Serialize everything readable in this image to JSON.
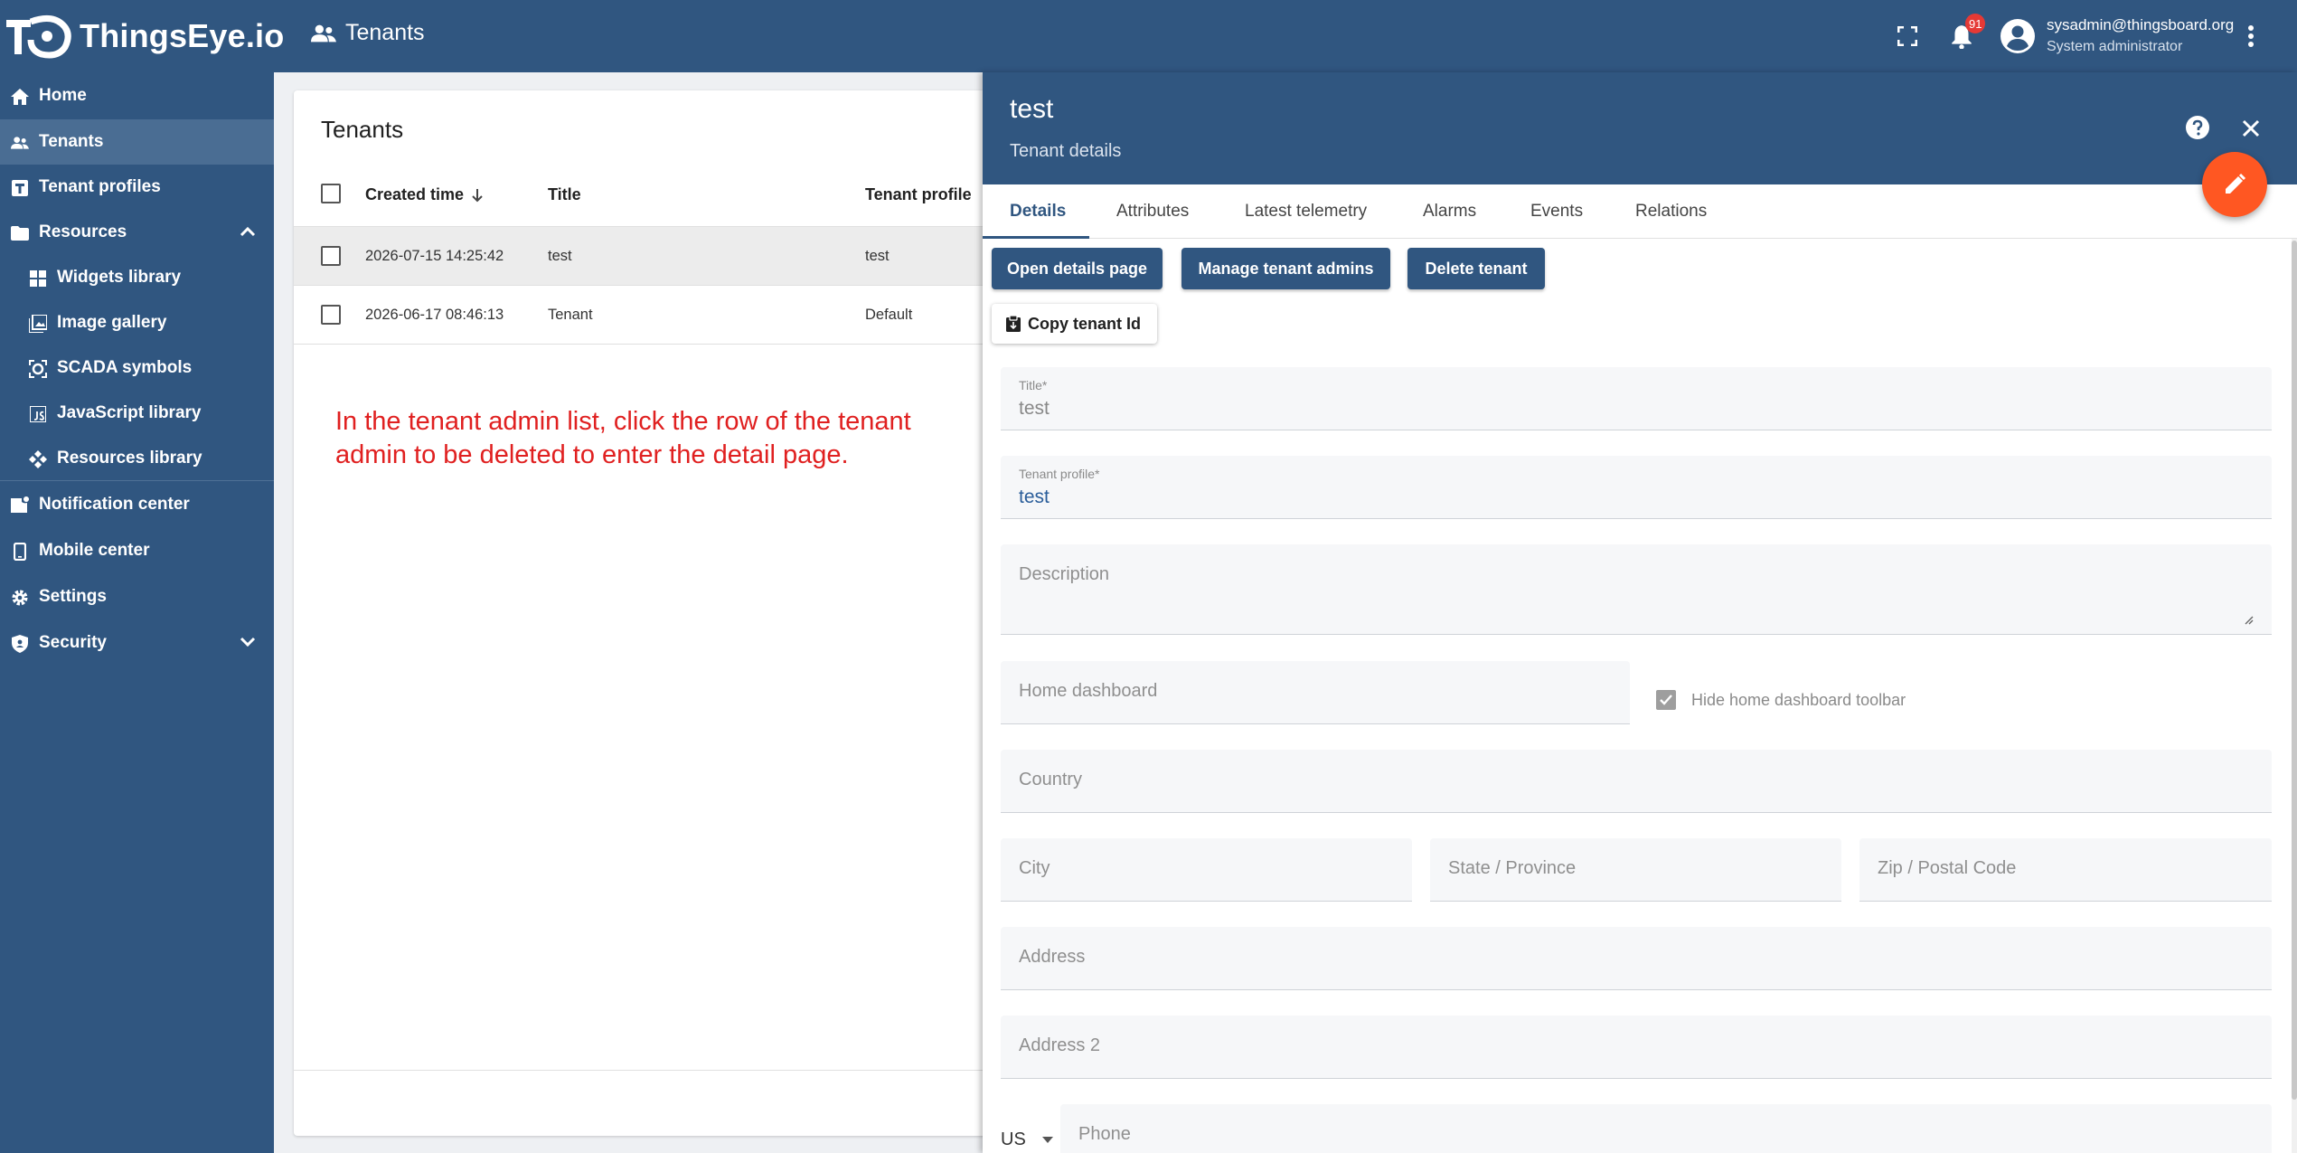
{
  "app": {
    "brand": "ThingsEye.io",
    "breadcrumb": "Tenants"
  },
  "topbar": {
    "notifications_count": "91",
    "user_email": "sysadmin@thingsboard.org",
    "user_role": "System administrator"
  },
  "sidebar": {
    "items": [
      {
        "label": "Home"
      },
      {
        "label": "Tenants"
      },
      {
        "label": "Tenant profiles"
      },
      {
        "label": "Resources"
      },
      {
        "label": "Widgets library"
      },
      {
        "label": "Image gallery"
      },
      {
        "label": "SCADA symbols"
      },
      {
        "label": "JavaScript library"
      },
      {
        "label": "Resources library"
      },
      {
        "label": "Notification center"
      },
      {
        "label": "Mobile center"
      },
      {
        "label": "Settings"
      },
      {
        "label": "Security"
      }
    ]
  },
  "tenants": {
    "title": "Tenants",
    "columns": [
      "Created time",
      "Title",
      "Tenant profile"
    ],
    "rows": [
      {
        "created": "2026-07-15 14:25:42",
        "title": "test",
        "profile": "test"
      },
      {
        "created": "2026-06-17 08:46:13",
        "title": "Tenant",
        "profile": "Default"
      }
    ],
    "annotation": "In the tenant admin list, click the row of the tenant admin to be deleted to enter the detail page."
  },
  "details": {
    "title": "test",
    "subtitle": "Tenant details",
    "tabs": [
      "Details",
      "Attributes",
      "Latest telemetry",
      "Alarms",
      "Events",
      "Relations"
    ],
    "buttons": {
      "open": "Open details page",
      "manage": "Manage tenant admins",
      "delete": "Delete tenant",
      "copy": "Copy tenant Id"
    },
    "fields": {
      "title_label": "Title*",
      "title_value": "test",
      "profile_label": "Tenant profile*",
      "profile_value": "test",
      "description": "Description",
      "home_dashboard": "Home dashboard",
      "hide_toolbar": "Hide home dashboard toolbar",
      "country": "Country",
      "city": "City",
      "state": "State / Province",
      "zip": "Zip / Postal Code",
      "address": "Address",
      "address2": "Address 2",
      "country_code": "US",
      "phone": "Phone"
    }
  },
  "colors": {
    "primary": "#305680",
    "accent": "#ff5722",
    "annotation": "#e02020"
  }
}
